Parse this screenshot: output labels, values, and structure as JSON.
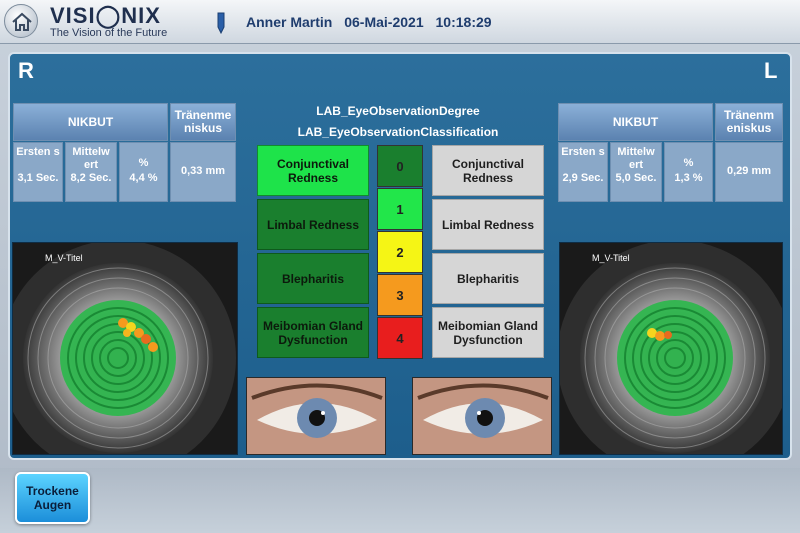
{
  "header": {
    "logo_name": "VISI◯NIX",
    "tagline": "The Vision of the Future",
    "patient": "Anner Martin",
    "date": "06-Mai-2021",
    "time": "10:18:29"
  },
  "right_eye": {
    "side": "R",
    "table": {
      "nikbut_header": "NIKBUT",
      "meniscus_header": "Tränenme niskus",
      "first_label": "Ersten s",
      "first_value": "3,1 Sec.",
      "mean_label": "Mittelw ert",
      "mean_value": "8,2 Sec.",
      "pct_label": "%",
      "pct_value": "4,4 %",
      "meniscus_value": "0,33 mm"
    },
    "image_title": "M_V-Titel"
  },
  "left_eye": {
    "side": "L",
    "table": {
      "nikbut_header": "NIKBUT",
      "meniscus_header": "Tränenm eniskus",
      "first_label": "Ersten s",
      "first_value": "2,9 Sec.",
      "mean_label": "Mittelw ert",
      "mean_value": "5,0 Sec.",
      "pct_label": "%",
      "pct_value": "1,3 %",
      "meniscus_value": "0,29 mm"
    },
    "image_title": "M_V-Titel"
  },
  "center": {
    "degree_title": "LAB_EyeObservationDegree",
    "class_title": "LAB_EyeObservationClassification",
    "right_classes": [
      {
        "label": "Conjunctival Redness",
        "state": "bright"
      },
      {
        "label": "Limbal Redness",
        "state": "green"
      },
      {
        "label": "Blepharitis",
        "state": "green"
      },
      {
        "label": "Meibomian Gland Dysfunction",
        "state": "green"
      }
    ],
    "left_classes": [
      {
        "label": "Conjunctival Redness",
        "state": "grey"
      },
      {
        "label": "Limbal Redness",
        "state": "grey"
      },
      {
        "label": "Blepharitis",
        "state": "grey"
      },
      {
        "label": "Meibomian Gland Dysfunction",
        "state": "grey"
      }
    ],
    "scale": [
      {
        "value": "0",
        "color": "#1a7f2e"
      },
      {
        "value": "1",
        "color": "#22e64a"
      },
      {
        "value": "2",
        "color": "#f5f515"
      },
      {
        "value": "3",
        "color": "#f59a1e"
      },
      {
        "value": "4",
        "color": "#e81e1e"
      }
    ]
  },
  "footer": {
    "dry_eyes_button": "Trockene Augen"
  },
  "colors": {
    "panel": "#226896",
    "accent_green": "#22e64a",
    "accent_blue": "#1c8ed9"
  }
}
